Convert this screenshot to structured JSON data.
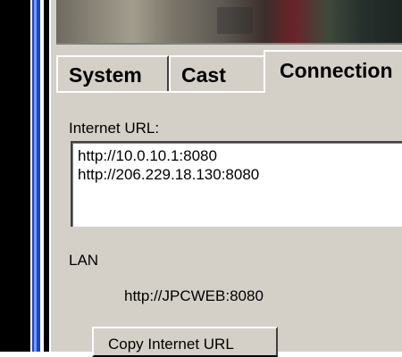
{
  "tabs": [
    {
      "label": "System"
    },
    {
      "label": "Cast"
    },
    {
      "label": "Connection"
    }
  ],
  "active_tab": "Connection",
  "internet": {
    "label": "Internet URL:",
    "urls": [
      "http://10.0.10.1:8080",
      "http://206.229.18.130:8080"
    ]
  },
  "lan": {
    "label": "LAN",
    "url": "http://JPCWEB:8080"
  },
  "buttons": {
    "copy_internet_url": "Copy Internet URL"
  }
}
